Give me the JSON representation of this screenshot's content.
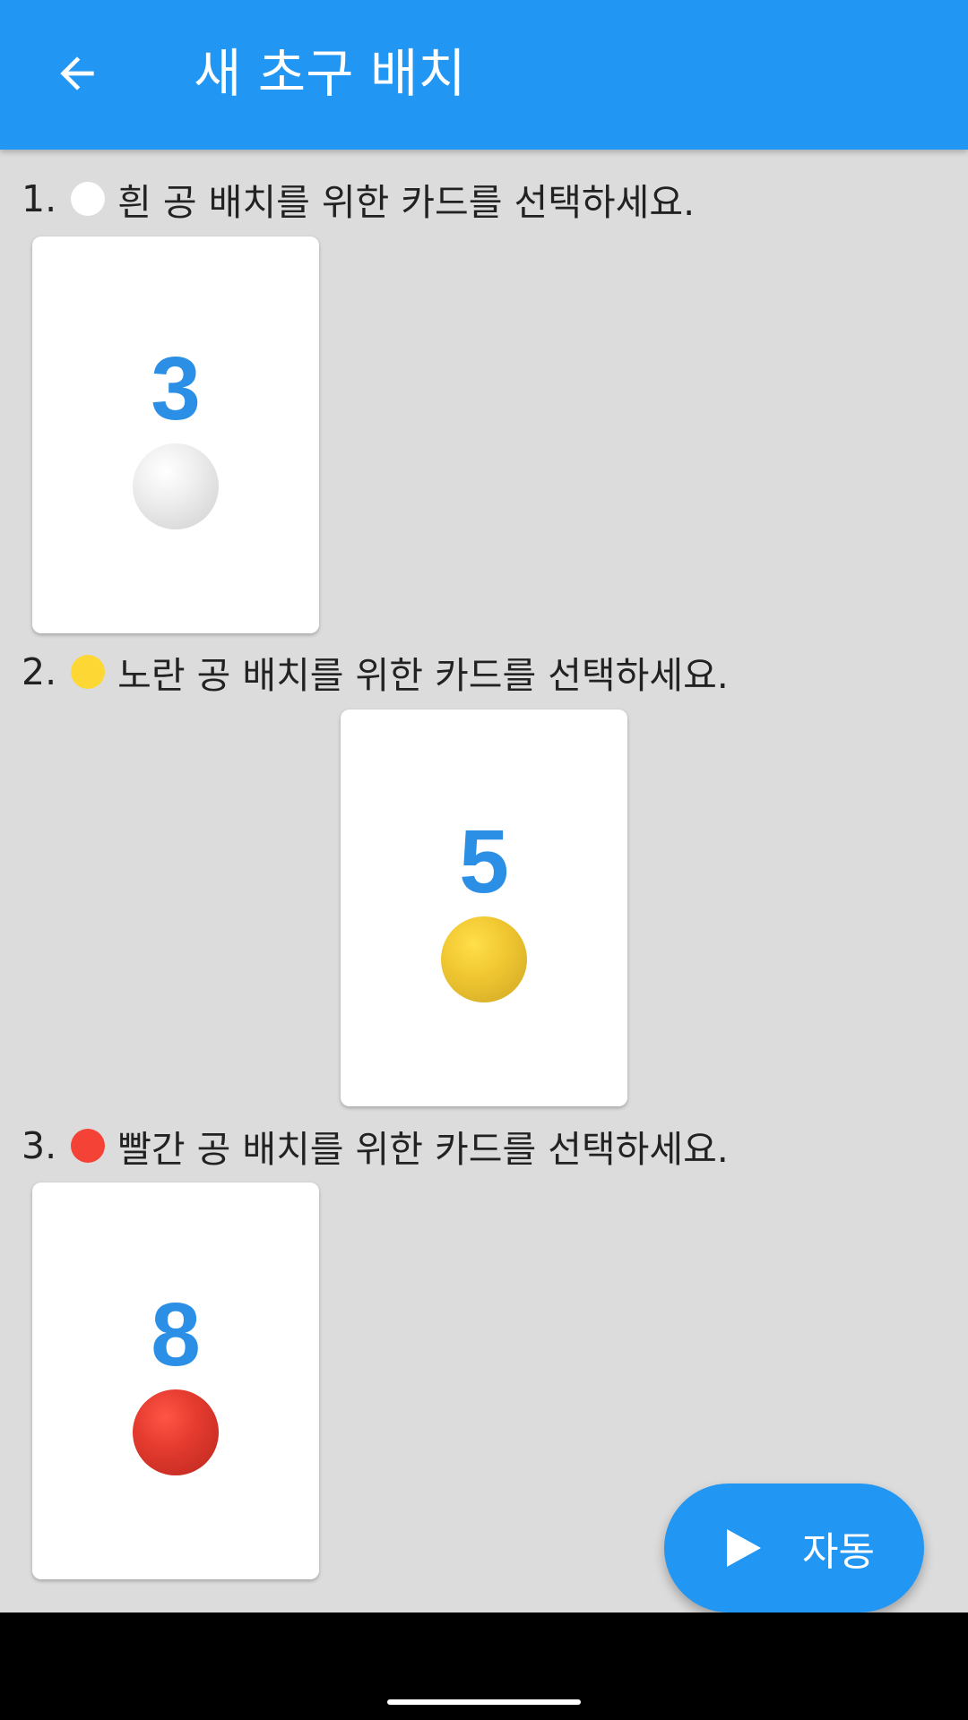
{
  "app_bar": {
    "title": "새 초구 배치",
    "back_icon": "arrow-left-icon",
    "background": "#2196f3"
  },
  "steps": [
    {
      "number": "1.",
      "text": "흰 공 배치를 위한 카드를 선택하세요.",
      "ball_color": "#ffffff",
      "card_value": "3",
      "card_ball": "white"
    },
    {
      "number": "2.",
      "text": "노란 공 배치를 위한 카드를 선택하세요.",
      "ball_color": "#fdd835",
      "card_value": "5",
      "card_ball": "yellow"
    },
    {
      "number": "3.",
      "text": "빨간 공 배치를 위한 카드를 선택하세요.",
      "ball_color": "#f44336",
      "card_value": "8",
      "card_ball": "red"
    }
  ],
  "fab": {
    "label": "자동",
    "icon": "play-icon"
  },
  "colors": {
    "accent": "#2196f3",
    "card_number": "#2b8fe6",
    "background": "#dcdcdc"
  }
}
